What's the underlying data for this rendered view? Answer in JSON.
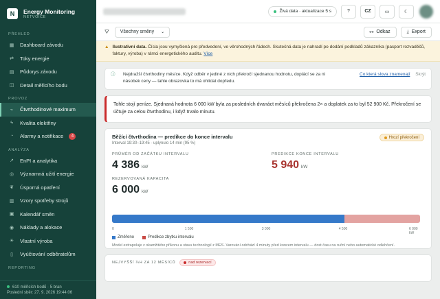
{
  "brand": {
    "logo": "N",
    "title": "Energy Monitoring",
    "subtitle": "NETVOICE"
  },
  "sidebar": {
    "sections": [
      {
        "label": "PŘEHLED",
        "items": [
          {
            "label": "Dashboard závodu",
            "icon": "dashboard-icon"
          },
          {
            "label": "Toky energie",
            "icon": "flow-icon"
          },
          {
            "label": "Půdorys závodu",
            "icon": "map-icon"
          },
          {
            "label": "Detail měřicího bodu",
            "icon": "meter-icon"
          }
        ]
      },
      {
        "label": "PROVOZ",
        "items": [
          {
            "label": "Čtvrthodinové maximum",
            "icon": "peak-icon",
            "active": true
          },
          {
            "label": "Kvalita elektřiny",
            "icon": "bolt-icon"
          },
          {
            "label": "Alarmy a notifikace",
            "icon": "bell-icon",
            "badge": "4"
          }
        ]
      },
      {
        "label": "ANALÝZA",
        "items": [
          {
            "label": "EnPI a analytika",
            "icon": "analytics-icon"
          },
          {
            "label": "Významná užití energie",
            "icon": "target-icon"
          },
          {
            "label": "Úsporná opatření",
            "icon": "leaf-icon"
          },
          {
            "label": "Vzory spotřeby strojů",
            "icon": "machine-icon"
          },
          {
            "label": "Kalendář směn",
            "icon": "calendar-icon"
          },
          {
            "label": "Náklady a alokace",
            "icon": "coins-icon"
          },
          {
            "label": "Vlastní výroba",
            "icon": "solar-icon"
          },
          {
            "label": "Vyúčtování odběratelům",
            "icon": "invoice-icon"
          }
        ]
      }
    ],
    "reporting_label": "REPORTING",
    "footer_status": "610 měřicích bodů · 5 bran",
    "footer_time": "Poslední sběr: 27. 9. 2026 19:44:06"
  },
  "topbar": {
    "live_label": "Živá data · aktualizace 5 s",
    "help": "?",
    "lang": "CZ",
    "display": "▭",
    "theme": "☾"
  },
  "filterbar": {
    "shift_select": "Všechny směny",
    "link_button": "Odkaz",
    "export_button": "Export"
  },
  "illustrative": {
    "bold": "Ilustrativní data.",
    "text": " Čísla jsou vymyšlená pro předvedení, ve věrohodných řádech. Skutečná data je nahradí po dodání podkladů zákazníka (pasport rozvaděčů, faktury, výroba) v rámci energetického auditu.",
    "more": "Více"
  },
  "hint": {
    "text": "Nejdražší čtvrthodiny měsíce. Když odběr v jediné z nich překročí sjednanou hodnotu, doplácí se za ni násobek ceny — tahle obrazovka to má ohlídat dopředu.",
    "link": "Co která slova znamenají",
    "hide": "Skrýt"
  },
  "alert": {
    "text": "Tohle stojí peníze. Sjednaná hodnota 6 000 kW byla za posledních dvanáct měsíců překročena 2× a doplatek za to byl 52 900 Kč. Překročení se účtuje za celou čtvrthodinu, i když trvalo minutu."
  },
  "interval": {
    "title": "Běžící čtvrthodina — predikce do konce intervalu",
    "subtitle": "Interval 19:30–19:45 · uplynulo 14 min (95 %)",
    "status_pill": "Hrozí překročení",
    "avg_label": "PRŮMĚR OD ZAČÁTKU INTERVALU",
    "avg_value": "4 386",
    "pred_label": "PREDIKCE KONCE INTERVALU",
    "pred_value": "5 940",
    "cap_label": "REZERVOVANÁ KAPACITA",
    "cap_value": "6 000",
    "unit": "kW",
    "bar_measured_kw": 4530,
    "bar_max_kw": 6000,
    "bar_predicted_kw": 5940,
    "ticks": [
      "0",
      "1 500",
      "3 000",
      "4 500",
      "6 000 kW"
    ],
    "legend_measured": "Změřeno",
    "legend_predicted": "Predikce zbytku intervalu",
    "note": "Model extrapoluje z okamžitého příkonu a stavu technologií z MES. Varování odchází 4 minuty před koncem intervalu — dost času na ruční nebo automatické odlehčení.",
    "color_measured": "#3579c9",
    "color_predicted": "#e3a3a1"
  },
  "highest": {
    "label": "NEJVYŠŠÍ ¼H ZA 12 MĚSÍCŮ",
    "pill": "nad rezervací"
  }
}
